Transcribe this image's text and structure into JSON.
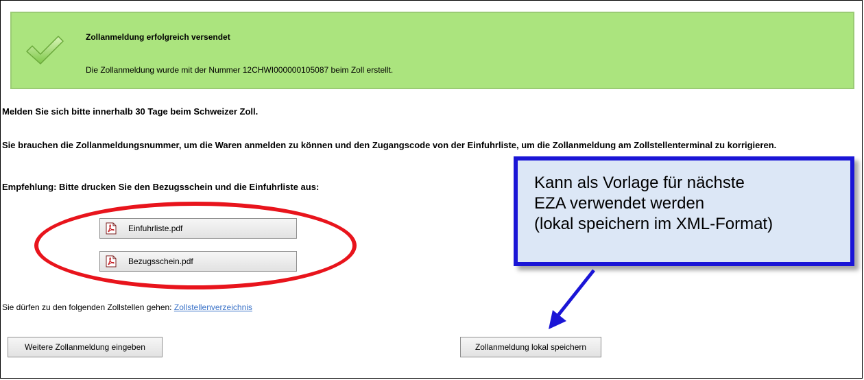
{
  "banner": {
    "title": "Zollanmeldung erfolgreich versendet",
    "message": "Die Zollanmeldung wurde mit der Nummer 12CHWI000000105087 beim Zoll erstellt.",
    "icon": "checkmark-icon",
    "color": "#abe47e"
  },
  "instructions": {
    "report": "Melden Sie sich bitte innerhalb 30 Tage beim Schweizer Zoll.",
    "need_number": "Sie brauchen die Zollanmeldungsnummer, um die Waren anmelden zu können und den Zugangscode von der Einfuhrliste, um die Zollanmeldung am Zollstellenterminal zu korrigieren.",
    "recommendation": "Empfehlung: Bitte drucken Sie den Bezugsschein und die Einfuhrliste aus:"
  },
  "documents": [
    {
      "label": "Einfuhrliste.pdf",
      "icon": "pdf-icon"
    },
    {
      "label": "Bezugsschein.pdf",
      "icon": "pdf-icon"
    }
  ],
  "offices": {
    "text": "Sie dürfen zu den folgenden Zollstellen gehen:",
    "link": "Zollstellenverzeichnis"
  },
  "actions": {
    "new_declaration": "Weitere Zollanmeldung eingeben",
    "save_local": "Zollanmeldung lokal speichern"
  },
  "callout": {
    "line1": "Kann als Vorlage für nächste",
    "line2": "EZA verwendet werden",
    "line3": "(lokal speichern im XML-Format)",
    "border_color": "#1a15d6",
    "background": "#dce7f6"
  },
  "highlight_color": "#e8141c"
}
